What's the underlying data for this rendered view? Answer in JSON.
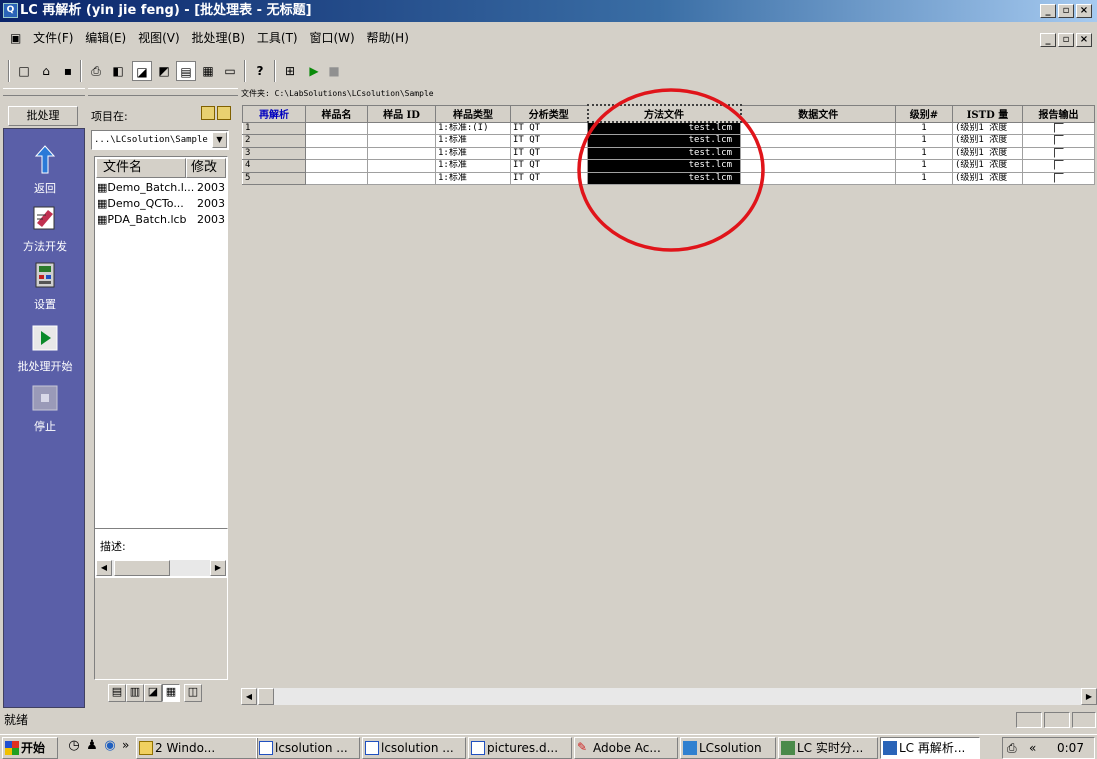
{
  "window": {
    "title": "LC 再解析 (yin jie feng) - [批处理表 - 无标题]",
    "icon_text": "Q"
  },
  "menu": [
    "文件(F)",
    "编辑(E)",
    "视图(V)",
    "批处理(B)",
    "工具(T)",
    "窗口(W)",
    "帮助(H)"
  ],
  "toolbar": {
    "help_glyph": "?"
  },
  "nav": {
    "header": "批处理",
    "items": [
      {
        "label": "返回",
        "icon": "return-arrow-icon"
      },
      {
        "label": "方法开发",
        "icon": "method-dev-icon"
      },
      {
        "label": "设置",
        "icon": "settings-icon"
      },
      {
        "label": "批处理开始",
        "icon": "play-icon"
      },
      {
        "label": "停止",
        "icon": "stop-icon"
      }
    ]
  },
  "files": {
    "project_label": "项目在:",
    "path": "...\\LCsolution\\Sample",
    "columns": [
      "文件名",
      "修改"
    ],
    "rows": [
      {
        "name": "Demo_Batch.l...",
        "mod": "2003-"
      },
      {
        "name": "Demo_QCTo...",
        "mod": "2003-"
      },
      {
        "name": "PDA_Batch.lcb",
        "mod": "2003-"
      }
    ],
    "desc_label": "描述:"
  },
  "grid": {
    "folder": "文件夹: C:\\LabSolutions\\LCsolution\\Sample",
    "headers": [
      "再解析",
      "样品名",
      "样品 ID",
      "样品类型",
      "分析类型",
      "方法文件",
      "数据文件",
      "级别#",
      "ISTD 量",
      "报告输出"
    ],
    "rows": [
      {
        "n": "1",
        "type": "1:标准:(I)",
        "analysis": "IT QT",
        "method": "test.lcm",
        "level": "1",
        "istd": "(级别1 浓度"
      },
      {
        "n": "2",
        "type": "1:标准",
        "analysis": "IT QT",
        "method": "test.lcm",
        "level": "1",
        "istd": "(级别1 浓度"
      },
      {
        "n": "3",
        "type": "1:标准",
        "analysis": "IT QT",
        "method": "test.lcm",
        "level": "1",
        "istd": "(级别1 浓度"
      },
      {
        "n": "4",
        "type": "1:标准",
        "analysis": "IT QT",
        "method": "test.lcm",
        "level": "1",
        "istd": "(级别1 浓度"
      },
      {
        "n": "5",
        "type": "1:标准",
        "analysis": "IT QT",
        "method": "test.lcm",
        "level": "1",
        "istd": "(级别1 浓度"
      }
    ]
  },
  "status": {
    "text": "就绪"
  },
  "taskbar": {
    "start": "开始",
    "chevron": "»",
    "tasks": [
      "2 Windo...",
      "lcsolution ...",
      "lcsolution ...",
      "pictures.d...",
      "Adobe Ac...",
      "LCsolution",
      "LC 实时分...",
      "LC 再解析..."
    ],
    "tray_chevron": "«",
    "clock": "0:07"
  },
  "colors": {
    "title_start": "#0a246a",
    "nav_bg": "#5a5fa8",
    "annotation_circle": "#e0141a",
    "header_blue": "#0000c0"
  }
}
